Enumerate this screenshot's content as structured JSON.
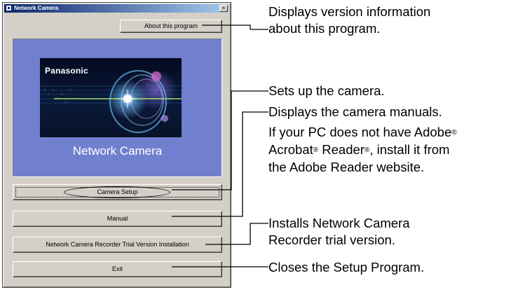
{
  "window": {
    "title": "Network Camera",
    "close_label": "×"
  },
  "buttons": {
    "about": "About this program",
    "camera_setup": "Camera Setup",
    "manual": "Manual",
    "recorder": "Network Camera Recorder Trial Version Installation",
    "exit": "Exit"
  },
  "banner": {
    "brand": "Panasonic",
    "product": "Network Camera"
  },
  "annotations": {
    "about": [
      "Displays version information",
      "about this program."
    ],
    "setup": "Sets up the camera.",
    "manual": "Displays the camera manuals.",
    "note": {
      "line1": "If your PC does not have Adobe",
      "line2a": "Acrobat",
      "line2b": " Reader",
      "line2c": ", install it from",
      "line3": "the Adobe Reader website.",
      "reg": "®"
    },
    "recorder": [
      "Installs Network Camera",
      "Recorder trial version."
    ],
    "exit": "Closes the Setup Program."
  }
}
